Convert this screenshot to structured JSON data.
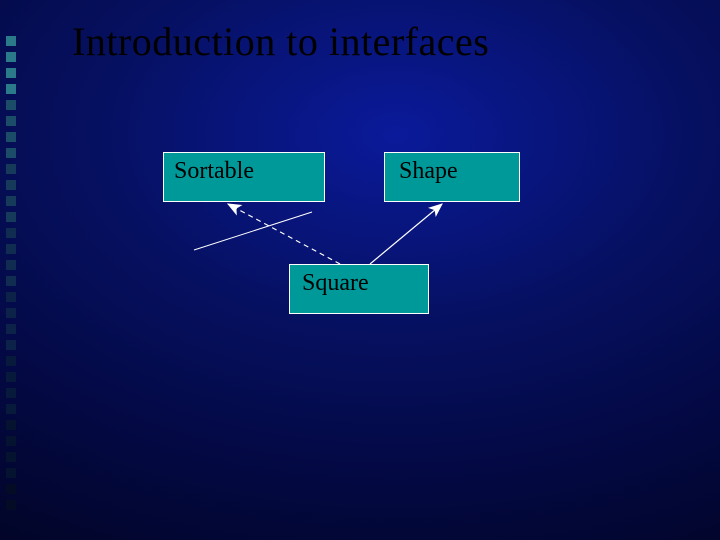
{
  "title": "Introduction to interfaces",
  "boxes": {
    "sortable": "Sortable",
    "shape": "Shape",
    "square": "Square"
  },
  "colors": {
    "box_fill": "#009999",
    "box_border": "#ffffff",
    "arrow": "#ffffff",
    "title": "#000000"
  },
  "decor_squares": [
    "#2a7a8a",
    "#2a7a8a",
    "#2a7a8a",
    "#2a7a8a",
    "#1c4d68",
    "#1c4d68",
    "#1c4d68",
    "#1c4d68",
    "#153a5a",
    "#153a5a",
    "#153a5a",
    "#153a5a",
    "#102c50",
    "#102c50",
    "#102c50",
    "#102c50",
    "#0c2248",
    "#0c2248",
    "#0c2248",
    "#0c2248",
    "#081a3c",
    "#081a3c",
    "#081a3c",
    "#081a3c",
    "#051230",
    "#051230",
    "#051230",
    "#051230",
    "#030c24",
    "#030c24"
  ]
}
